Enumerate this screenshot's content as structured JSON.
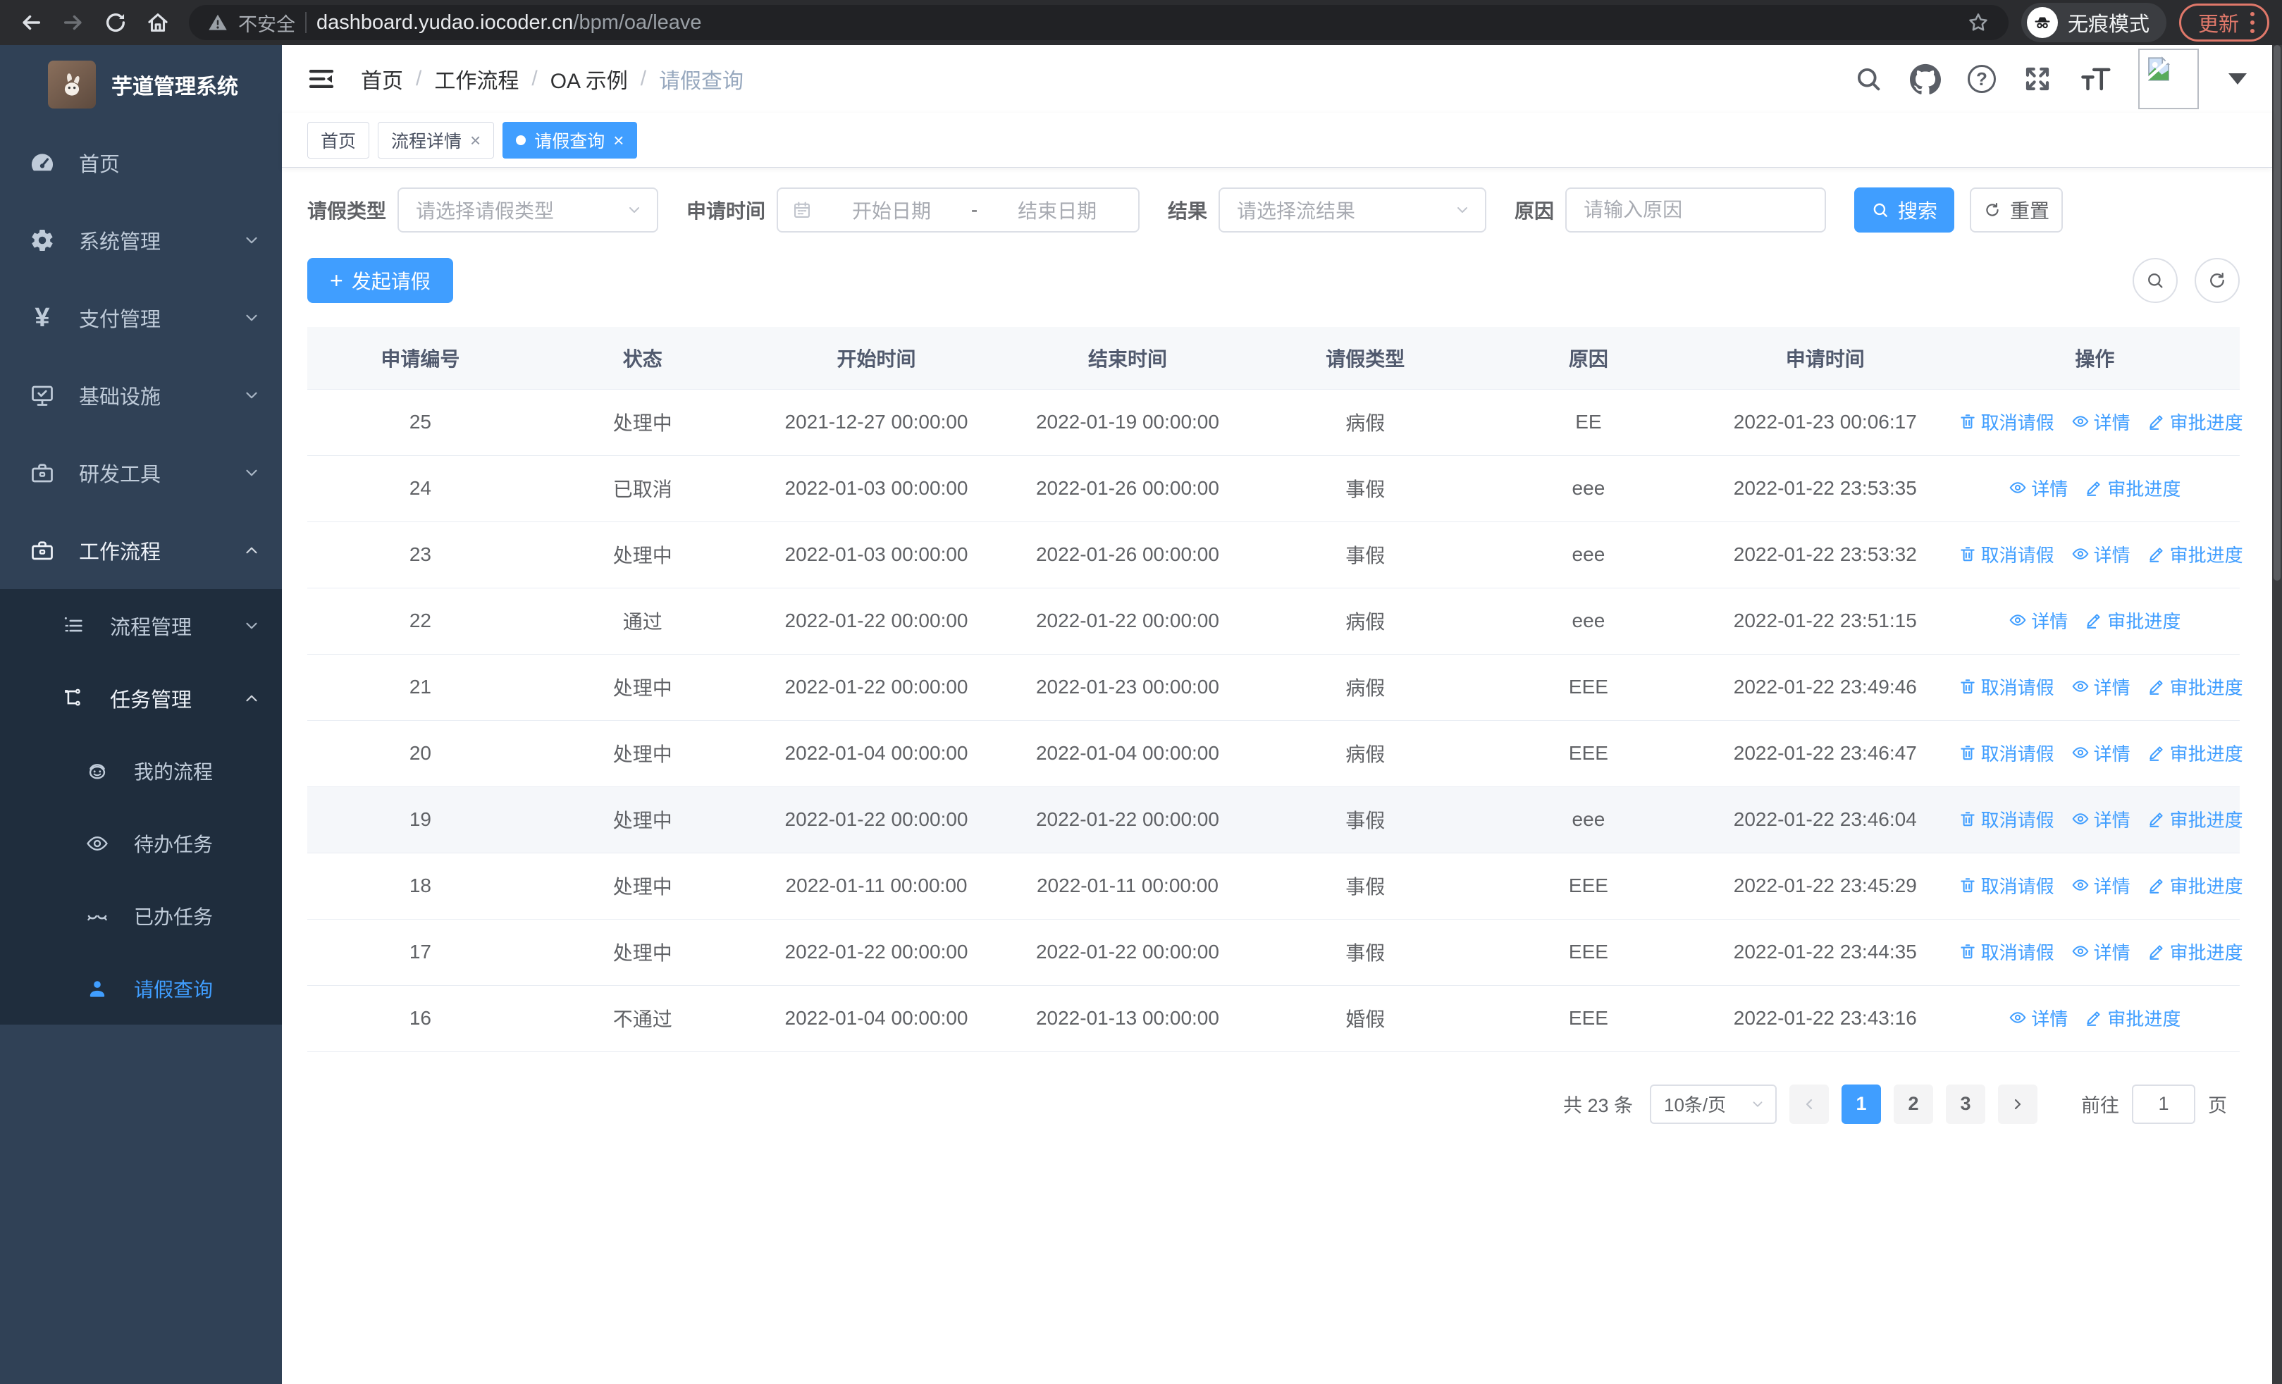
{
  "browser": {
    "security_label": "不安全",
    "url_host": "dashboard.yudao.iocoder.cn",
    "url_path": "/bpm/oa/leave",
    "incognito_label": "无痕模式",
    "update_label": "更新"
  },
  "icons": {
    "close": "×",
    "breadcrumb_separator": "/",
    "plus": "+",
    "yen": "¥",
    "question": "?",
    "date_separator": "-"
  },
  "sidebar": {
    "title": "芋道管理系统",
    "items": {
      "home": "首页",
      "system": "系统管理",
      "payment": "支付管理",
      "infra": "基础设施",
      "devtools": "研发工具",
      "workflow": "工作流程",
      "process_mgmt": "流程管理",
      "task_mgmt": "任务管理",
      "my_process": "我的流程",
      "todo_tasks": "待办任务",
      "done_tasks": "已办任务",
      "leave_query": "请假查询"
    }
  },
  "breadcrumb": {
    "items": [
      "首页",
      "工作流程",
      "OA 示例",
      "请假查询"
    ]
  },
  "tabs": [
    {
      "label": "首页"
    },
    {
      "label": "流程详情"
    },
    {
      "label": "请假查询"
    }
  ],
  "filters": {
    "leave_type_label": "请假类型",
    "leave_type_placeholder": "请选择请假类型",
    "apply_time_label": "申请时间",
    "date_start_placeholder": "开始日期",
    "date_end_placeholder": "结束日期",
    "result_label": "结果",
    "result_placeholder": "请选择流结果",
    "reason_label": "原因",
    "reason_placeholder": "请输入原因",
    "search_label": "搜索",
    "reset_label": "重置"
  },
  "toolbar": {
    "create_label": "发起请假"
  },
  "table": {
    "columns": [
      "申请编号",
      "状态",
      "开始时间",
      "结束时间",
      "请假类型",
      "原因",
      "申请时间",
      "操作"
    ],
    "action_defs": {
      "cancel": {
        "label": "取消请假",
        "icon": "trash"
      },
      "detail": {
        "label": "详情",
        "icon": "eye"
      },
      "progress": {
        "label": "审批进度",
        "icon": "pen"
      }
    },
    "rows": [
      {
        "id": "25",
        "status": "处理中",
        "start": "2021-12-27 00:00:00",
        "end": "2022-01-19 00:00:00",
        "type": "病假",
        "reason": "EE",
        "apply_time": "2022-01-23 00:06:17",
        "actions": [
          "cancel",
          "detail",
          "progress"
        ]
      },
      {
        "id": "24",
        "status": "已取消",
        "start": "2022-01-03 00:00:00",
        "end": "2022-01-26 00:00:00",
        "type": "事假",
        "reason": "eee",
        "apply_time": "2022-01-22 23:53:35",
        "actions": [
          "detail",
          "progress"
        ]
      },
      {
        "id": "23",
        "status": "处理中",
        "start": "2022-01-03 00:00:00",
        "end": "2022-01-26 00:00:00",
        "type": "事假",
        "reason": "eee",
        "apply_time": "2022-01-22 23:53:32",
        "actions": [
          "cancel",
          "detail",
          "progress"
        ]
      },
      {
        "id": "22",
        "status": "通过",
        "start": "2022-01-22 00:00:00",
        "end": "2022-01-22 00:00:00",
        "type": "病假",
        "reason": "eee",
        "apply_time": "2022-01-22 23:51:15",
        "actions": [
          "detail",
          "progress"
        ]
      },
      {
        "id": "21",
        "status": "处理中",
        "start": "2022-01-22 00:00:00",
        "end": "2022-01-23 00:00:00",
        "type": "病假",
        "reason": "EEE",
        "apply_time": "2022-01-22 23:49:46",
        "actions": [
          "cancel",
          "detail",
          "progress"
        ]
      },
      {
        "id": "20",
        "status": "处理中",
        "start": "2022-01-04 00:00:00",
        "end": "2022-01-04 00:00:00",
        "type": "病假",
        "reason": "EEE",
        "apply_time": "2022-01-22 23:46:47",
        "actions": [
          "cancel",
          "detail",
          "progress"
        ]
      },
      {
        "id": "19",
        "status": "处理中",
        "start": "2022-01-22 00:00:00",
        "end": "2022-01-22 00:00:00",
        "type": "事假",
        "reason": "eee",
        "apply_time": "2022-01-22 23:46:04",
        "actions": [
          "cancel",
          "detail",
          "progress"
        ],
        "hover": true
      },
      {
        "id": "18",
        "status": "处理中",
        "start": "2022-01-11 00:00:00",
        "end": "2022-01-11 00:00:00",
        "type": "事假",
        "reason": "EEE",
        "apply_time": "2022-01-22 23:45:29",
        "actions": [
          "cancel",
          "detail",
          "progress"
        ]
      },
      {
        "id": "17",
        "status": "处理中",
        "start": "2022-01-22 00:00:00",
        "end": "2022-01-22 00:00:00",
        "type": "事假",
        "reason": "EEE",
        "apply_time": "2022-01-22 23:44:35",
        "actions": [
          "cancel",
          "detail",
          "progress"
        ]
      },
      {
        "id": "16",
        "status": "不通过",
        "start": "2022-01-04 00:00:00",
        "end": "2022-01-13 00:00:00",
        "type": "婚假",
        "reason": "EEE",
        "apply_time": "2022-01-22 23:43:16",
        "actions": [
          "detail",
          "progress"
        ]
      }
    ]
  },
  "pagination": {
    "total": "共 23 条",
    "page_size": "10条/页",
    "pages": [
      "1",
      "2",
      "3"
    ],
    "active_page": "1",
    "goto": "前往",
    "goto_value": "1",
    "unit": "页"
  }
}
